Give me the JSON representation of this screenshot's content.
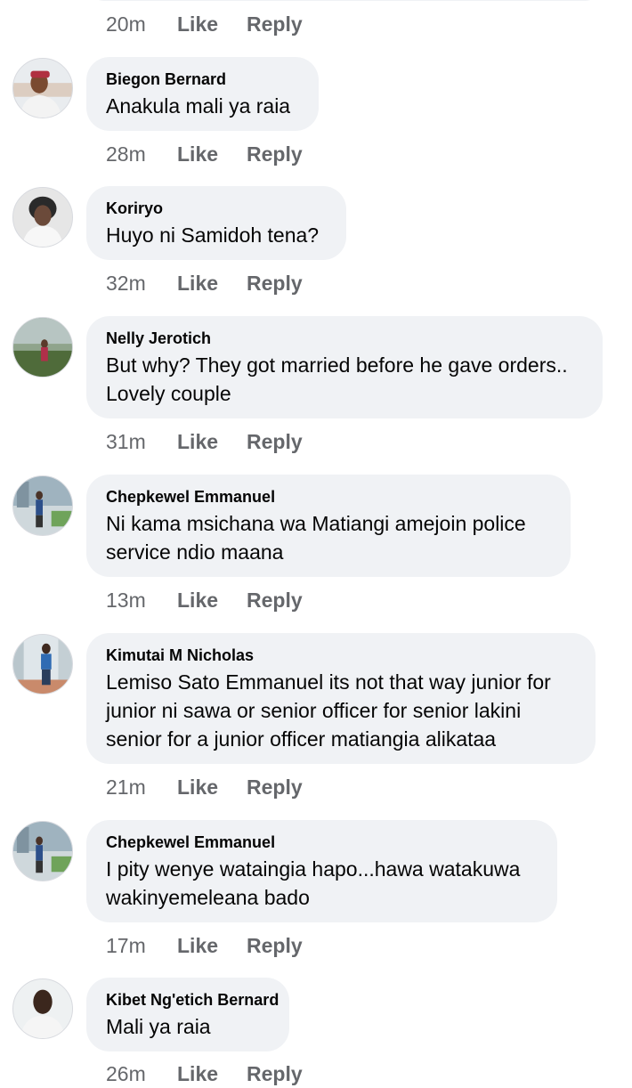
{
  "labels": {
    "like": "Like",
    "reply": "Reply"
  },
  "top_actions": {
    "time": "20m"
  },
  "comments": [
    {
      "author": "Biegon Bernard",
      "text": "Anakula mali ya raia",
      "time": "28m",
      "avatar_icon": "profile-photo"
    },
    {
      "author": "Koriryo",
      "text": "Huyo ni Samidoh tena?",
      "time": "32m",
      "avatar_icon": "profile-photo"
    },
    {
      "author": "Nelly Jerotich",
      "text": "But why? They got married before he gave orders.. Lovely couple",
      "time": "31m",
      "avatar_icon": "profile-photo"
    },
    {
      "author": "Chepkewel Emmanuel",
      "text": "Ni kama msichana wa Matiangi amejoin police service ndio maana",
      "time": "13m",
      "avatar_icon": "profile-photo"
    },
    {
      "author": "Kimutai M Nicholas",
      "text": "Lemiso Sato Emmanuel its not that way junior for junior ni sawa or senior officer for senior lakini senior for a junior officer matiangia alikataa",
      "time": "21m",
      "avatar_icon": "profile-photo"
    },
    {
      "author": "Chepkewel Emmanuel",
      "text": "I pity wenye wataingia hapo...hawa watakuwa wakinyemeleana bado",
      "time": "17m",
      "avatar_icon": "profile-photo"
    },
    {
      "author": "Kibet Ng'etich Bernard",
      "text": "Mali ya raia",
      "time": "26m",
      "avatar_icon": "profile-photo"
    }
  ],
  "colors": {
    "bubble_bg": "#f0f2f5",
    "meta_text": "#65676b",
    "body_text": "#050505"
  }
}
